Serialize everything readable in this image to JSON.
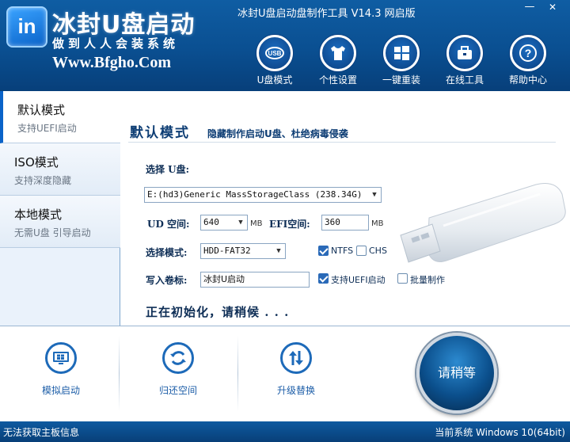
{
  "window": {
    "title": "冰封U盘启动盘制作工具 V14.3 网启版",
    "minimize_glyph": "—",
    "close_glyph": "✕"
  },
  "brand": {
    "logo_text": "in",
    "name": "冰封U盘启动",
    "slogan": "做到人人会装系统",
    "url": "Www.Bfgho.Com"
  },
  "nav": [
    {
      "label": "U盘模式",
      "icon": "usb-icon"
    },
    {
      "label": "个性设置",
      "icon": "tshirt-icon"
    },
    {
      "label": "一键重装",
      "icon": "windows-icon"
    },
    {
      "label": "在线工具",
      "icon": "toolbox-icon"
    },
    {
      "label": "帮助中心",
      "icon": "help-icon"
    }
  ],
  "sidebar": [
    {
      "name": "默认模式",
      "sub": "支持UEFI启动"
    },
    {
      "name": "ISO模式",
      "sub": "支持深度隐藏"
    },
    {
      "name": "本地模式",
      "sub": "无需U盘 引导启动"
    }
  ],
  "main": {
    "title": "默认模式",
    "subtitle": "隐藏制作启动U盘、杜绝病毒侵袭",
    "select_disk_label": "选择 U盘:",
    "disk_value": "E:(hd3)Generic MassStorageClass (238.34G)",
    "ud_space_label": "UD 空间:",
    "ud_space_value": "640",
    "ud_unit": "MB",
    "efi_space_label": "EFI空间:",
    "efi_space_value": "360",
    "efi_unit": "MB",
    "mode_label": "选择模式:",
    "mode_value": "HDD-FAT32",
    "ntfs_label": "NTFS",
    "chs_label": "CHS",
    "volume_label": "写入卷标:",
    "volume_value": "冰封U启动",
    "uefi_label": "支持UEFI启动",
    "batch_label": "批量制作",
    "status": "正在初始化，请稍候 . . ."
  },
  "checkboxes": {
    "ntfs": true,
    "chs": false,
    "uefi": true,
    "batch": false
  },
  "tools": [
    {
      "label": "模拟启动",
      "icon": "monitor-icon"
    },
    {
      "label": "归还空间",
      "icon": "refresh-icon"
    },
    {
      "label": "升级替换",
      "icon": "upgrade-arrows-icon"
    }
  ],
  "wait_button": "请稍等",
  "statusbar": {
    "left": "无法获取主板信息",
    "right": "当前系统 Windows 10(64bit)"
  },
  "colors": {
    "header_blue": "#0a4f91",
    "accent": "#1d6ab9",
    "title_dark": "#0d3d74"
  }
}
